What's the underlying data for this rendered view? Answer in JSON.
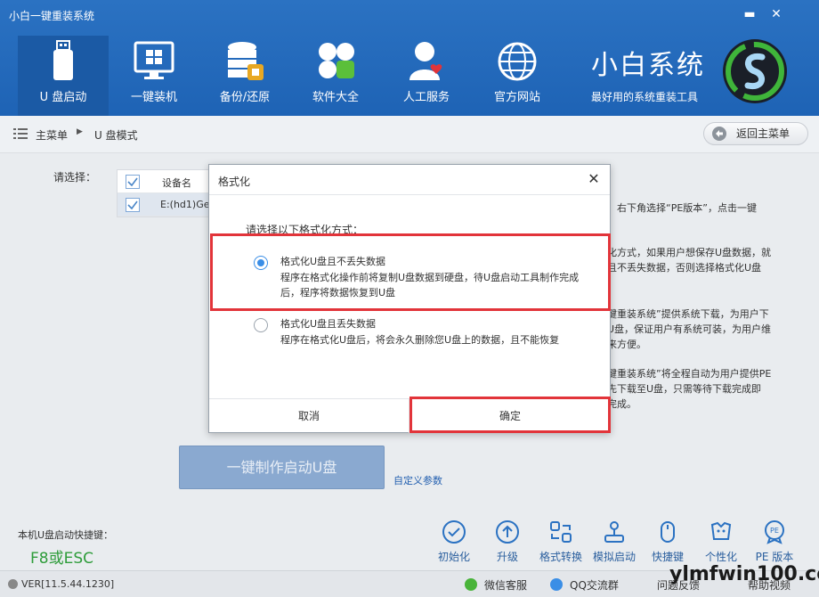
{
  "window": {
    "title": "小白一键重装系统",
    "minimize_glyph": "▬",
    "close_glyph": "✕"
  },
  "nav": {
    "items": [
      {
        "label": "U 盘启动",
        "icon": "usb-drive-icon"
      },
      {
        "label": "一键装机",
        "icon": "monitor-windows-icon"
      },
      {
        "label": "备份/还原",
        "icon": "database-backup-icon"
      },
      {
        "label": "软件大全",
        "icon": "software-grid-icon"
      },
      {
        "label": "人工服务",
        "icon": "support-person-icon"
      },
      {
        "label": "官方网站",
        "icon": "globe-icon"
      }
    ]
  },
  "brand": {
    "name": "小白系统",
    "slogan": "最好用的系统重装工具"
  },
  "breadcrumb": {
    "main": "主菜单",
    "arrow": "▶",
    "current": "U 盘模式",
    "back_label": "返回主菜单"
  },
  "main": {
    "choose_label": "请选择：",
    "table": {
      "header": "设备名",
      "rows": [
        "E:(hd1)Ge"
      ]
    },
    "side_text": [
      "，右下角选择“PE版本”，点击一键",
      "化方式，如果用户想保存U盘数据，就",
      "且不丢失数据，否则选择格式化U盘",
      "键重装系统”提供系统下载，为用户下",
      "U盘，保证用户有系统可装，为用户维",
      "来方便。",
      "键重装系统”将全程自动为用户提供PE",
      "先下载至U盘，只需等待下载完成即",
      "完成。"
    ],
    "make_button": "一键制作启动U盘",
    "custom_link": "自定义参数"
  },
  "bottom": {
    "hotkey_label": "本机U盘启动快捷键：",
    "hotkey_value": "F8或ESC",
    "tools": [
      {
        "label": "初始化",
        "icon": "check-circle-icon"
      },
      {
        "label": "升级",
        "icon": "upgrade-arrow-icon"
      },
      {
        "label": "格式转换",
        "icon": "format-convert-icon"
      },
      {
        "label": "模拟启动",
        "icon": "joystick-icon"
      },
      {
        "label": "快捷键",
        "icon": "mouse-icon"
      },
      {
        "label": "个性化",
        "icon": "personalize-icon"
      },
      {
        "label": "PE 版本",
        "icon": "pe-badge-icon"
      }
    ]
  },
  "status": {
    "version": "VER[11.5.44.1230]",
    "wechat": "微信客服",
    "qq": "QQ交流群",
    "feedback": "问题反馈",
    "help": "帮助视频",
    "watermark": "ylmfwin100.com"
  },
  "dialog": {
    "title": "格式化",
    "close": "✕",
    "prompt": "请选择以下格式化方式：",
    "options": [
      {
        "title": "格式化U盘且不丢失数据",
        "desc": "程序在格式化操作前将复制U盘数据到硬盘，待U盘启动工具制作完成后，程序将数据恢复到U盘",
        "selected": true
      },
      {
        "title": "格式化U盘且丢失数据",
        "desc": "程序在格式化U盘后，将会永久删除您U盘上的数据，且不能恢复",
        "selected": false
      }
    ],
    "cancel": "取消",
    "ok": "确定"
  },
  "colors": {
    "header_bg": "#2b72c2",
    "highlight_border": "#e2343a",
    "radio_accent": "#3a8ee6",
    "hotkey_green": "#2e9c3a"
  }
}
